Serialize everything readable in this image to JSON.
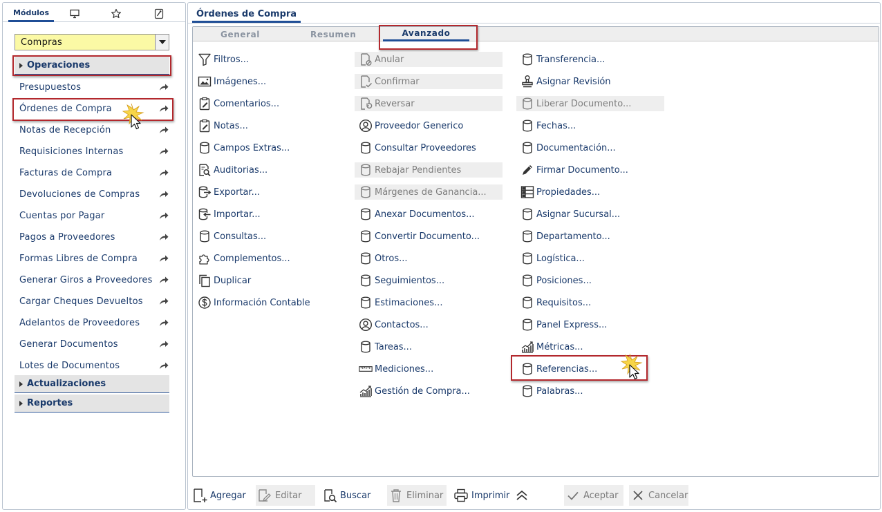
{
  "left_panel": {
    "tabs": {
      "modules_label": "Módulos"
    },
    "module_select": {
      "value": "Compras"
    },
    "sections": {
      "operaciones": "Operaciones",
      "actualizaciones": "Actualizaciones",
      "reportes": "Reportes"
    },
    "items": [
      "Presupuestos",
      "Órdenes de Compra",
      "Notas de Recepción",
      "Requisiciones Internas",
      "Facturas de Compra",
      "Devoluciones de Compras",
      "Cuentas por Pagar",
      "Pagos a Proveedores",
      "Formas Libres de Compra",
      "Generar Giros a Proveedores",
      "Cargar Cheques Devueltos",
      "Adelantos de Proveedores",
      "Generar Documentos",
      "Lotes de Documentos"
    ]
  },
  "right_panel": {
    "tab_title": "Órdenes de Compra",
    "subtabs": {
      "general": "General",
      "resumen": "Resumen",
      "avanzado": "Avanzado"
    },
    "col1": [
      {
        "label": "Filtros...",
        "icon": "funnel-icon"
      },
      {
        "label": "Imágenes...",
        "icon": "image-icon"
      },
      {
        "label": "Comentarios...",
        "icon": "clipboard-edit-icon"
      },
      {
        "label": "Notas...",
        "icon": "clipboard-edit-icon"
      },
      {
        "label": "Campos Extras...",
        "icon": "database-icon"
      },
      {
        "label": "Auditorias...",
        "icon": "document-search-icon"
      },
      {
        "label": "Exportar...",
        "icon": "database-export-icon"
      },
      {
        "label": "Importar...",
        "icon": "database-import-icon"
      },
      {
        "label": "Consultas...",
        "icon": "database-icon"
      },
      {
        "label": "Complementos...",
        "icon": "puzzle-icon"
      },
      {
        "label": "Duplicar",
        "icon": "copy-icon"
      },
      {
        "label": "Información Contable",
        "icon": "dollar-circle-icon"
      }
    ],
    "col2": [
      {
        "label": "Anular",
        "icon": "document-cancel-icon",
        "disabled": true
      },
      {
        "label": "Confirmar",
        "icon": "document-check-icon",
        "disabled": true
      },
      {
        "label": "Reversar",
        "icon": "document-undo-icon",
        "disabled": true
      },
      {
        "label": "Proveedor Generico",
        "icon": "user-circle-icon"
      },
      {
        "label": "Consultar Proveedores",
        "icon": "database-icon"
      },
      {
        "label": "Rebajar Pendientes",
        "icon": "database-icon",
        "disabled": true
      },
      {
        "label": "Márgenes de Ganancia...",
        "icon": "database-icon",
        "disabled": true
      },
      {
        "label": "Anexar Documentos...",
        "icon": "database-icon"
      },
      {
        "label": "Convertir Documento...",
        "icon": "database-icon"
      },
      {
        "label": "Otros...",
        "icon": "database-icon"
      },
      {
        "label": "Seguimientos...",
        "icon": "database-icon"
      },
      {
        "label": "Estimaciones...",
        "icon": "database-icon"
      },
      {
        "label": "Contactos...",
        "icon": "user-circle-icon"
      },
      {
        "label": "Tareas...",
        "icon": "database-icon"
      },
      {
        "label": "Mediciones...",
        "icon": "ruler-icon"
      },
      {
        "label": "Gestión de Compra...",
        "icon": "chart-icon"
      }
    ],
    "col3": [
      {
        "label": "Transferencia...",
        "icon": "database-icon"
      },
      {
        "label": "Asignar Revisión",
        "icon": "stamp-icon"
      },
      {
        "label": "Liberar Documento...",
        "icon": "database-icon",
        "disabled": true
      },
      {
        "label": "Fechas...",
        "icon": "database-icon"
      },
      {
        "label": "Documentación...",
        "icon": "database-icon"
      },
      {
        "label": "Firmar Documento...",
        "icon": "pen-icon"
      },
      {
        "label": "Propiedades...",
        "icon": "properties-grid-icon"
      },
      {
        "label": "Asignar Sucursal...",
        "icon": "database-icon"
      },
      {
        "label": "Departamento...",
        "icon": "database-icon"
      },
      {
        "label": "Logística...",
        "icon": "database-icon"
      },
      {
        "label": "Posiciones...",
        "icon": "database-icon"
      },
      {
        "label": "Requisitos...",
        "icon": "database-icon"
      },
      {
        "label": "Panel Express...",
        "icon": "database-icon"
      },
      {
        "label": "Métricas...",
        "icon": "chart-icon"
      },
      {
        "label": "Referencias...",
        "icon": "database-icon"
      },
      {
        "label": "Palabras...",
        "icon": "database-icon"
      }
    ]
  },
  "toolbar": {
    "agregar": "Agregar",
    "editar": "Editar",
    "buscar": "Buscar",
    "eliminar": "Eliminar",
    "imprimir": "Imprimir",
    "aceptar": "Aceptar",
    "cancelar": "Cancelar"
  },
  "colors": {
    "accent": "#1f4e96",
    "text": "#1a3a6b",
    "highlight": "#b3282d",
    "select_bg": "#fbf9a5"
  }
}
